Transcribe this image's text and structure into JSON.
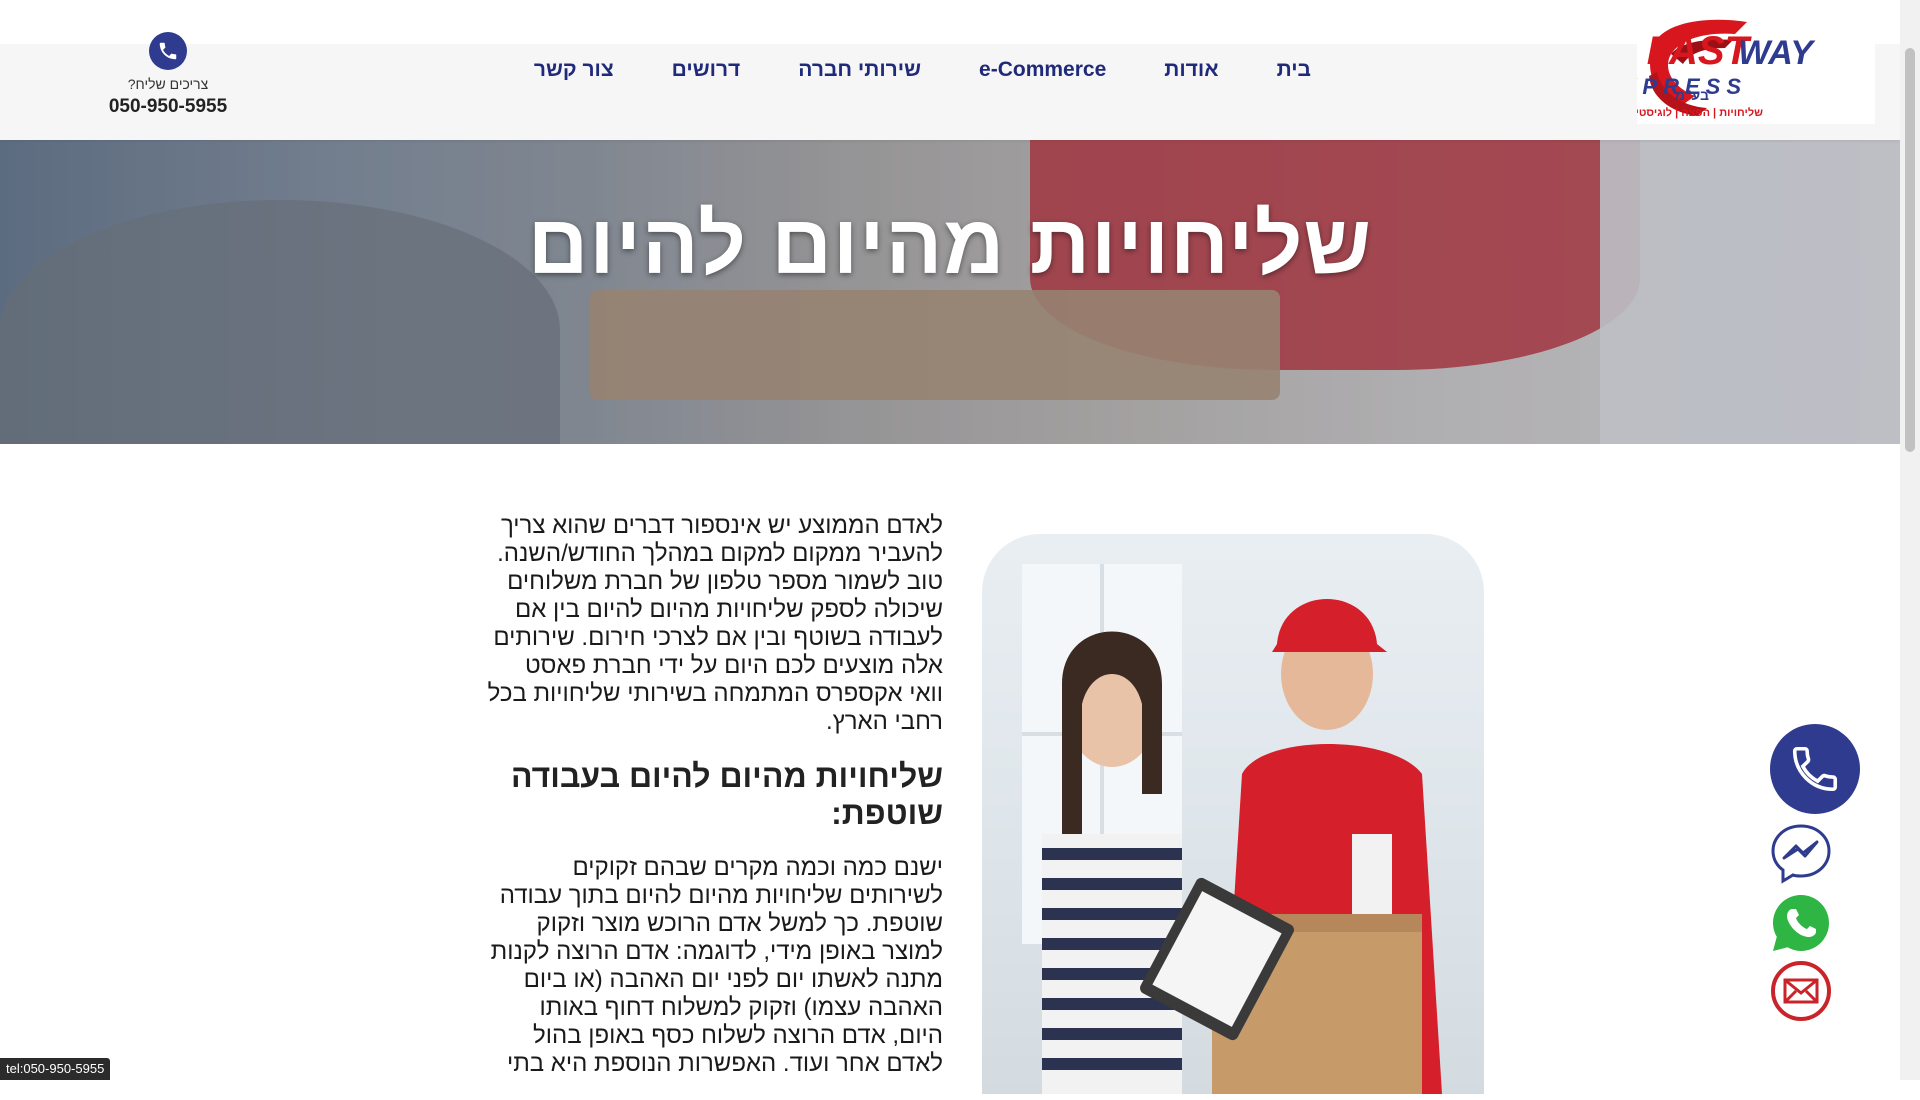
{
  "header": {
    "logo_text": "FAST WAY EXPRESS",
    "logo_suffix": "בע\"מ",
    "logo_tagline": "שליחויות | הפצה | לוגיסטיקה",
    "nav": [
      {
        "label": "בית"
      },
      {
        "label": "אודות"
      },
      {
        "label": "e-Commerce"
      },
      {
        "label": "שירותי חברה"
      },
      {
        "label": "דרושים"
      },
      {
        "label": "צור קשר"
      }
    ],
    "contact_question": "צריכים שליח?",
    "contact_phone": "050-950-5955"
  },
  "hero": {
    "title": "שליחויות מהיום להיום"
  },
  "content": {
    "intro": "לאדם הממוצע יש אינספור דברים שהוא צריך להעביר ממקום למקום במהלך החודש/השנה. טוב לשמור מספר טלפון של חברת משלוחים שיכולה לספק שליחויות מהיום להיום בין אם לעבודה בשוטף ובין אם לצרכי חירום. שירותים אלה מוצעים לכם היום על ידי חברת פאסט וואי אקספרס המתמחה בשירותי שליחויות בכל רחבי הארץ.",
    "heading": "שליחויות מהיום להיום בעבודה שוטפת:",
    "paragraph2": "ישנם כמה וכמה מקרים שבהם זקוקים לשירותים שליחויות מהיום להיום בתוך עבודה שוטפת. כך למשל אדם הרוכש מוצר וזקוק למוצר באופן מידי, לדוגמה: אדם הרוצה לקנות מתנה לאשתו יום לפני יום האהבה (או ביום האהבה עצמו) וזקוק למשלוח דחוף באותו היום, אדם הרוצה לשלוח כסף באופן בהול לאדם אחר ועוד. האפשרות הנוספת היא בתי"
  },
  "floating": {
    "call": "phone-icon",
    "messenger": "messenger-icon",
    "whatsapp": "whatsapp-icon",
    "email": "email-icon"
  },
  "status_bar": "tel:050-950-5955",
  "colors": {
    "brand_blue": "#2e3b8f",
    "nav_text": "#1f2a7a",
    "logo_red": "#d7161e",
    "whatsapp_green": "#2fb543",
    "email_red": "#c8242a"
  }
}
